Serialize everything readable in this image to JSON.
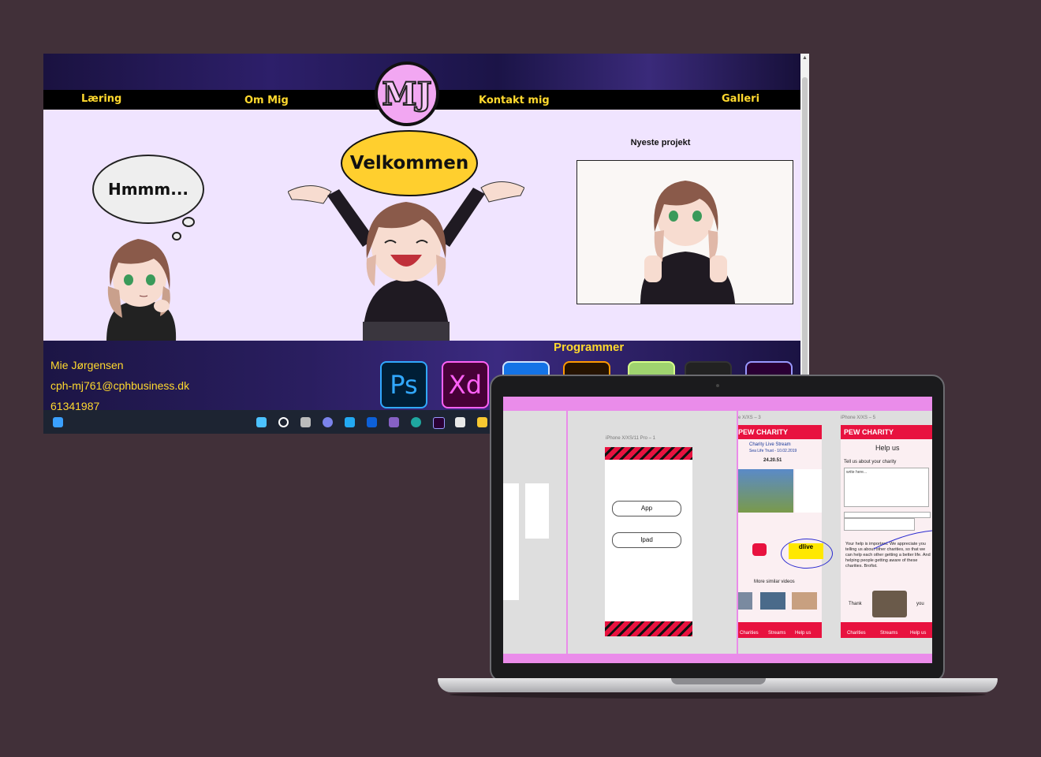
{
  "site": {
    "nav": [
      "Læring",
      "Om Mig",
      "Kontakt mig",
      "Galleri"
    ],
    "logo_text": "MJ",
    "thought_text": "Hmmm...",
    "welcome_text": "Velkommen",
    "project_title": "Nyeste projekt",
    "footer": {
      "programs_title": "Programmer",
      "name": "Mie Jørgensen",
      "email": "cph-mj761@cphbusiness.dk",
      "phone": "61341987"
    },
    "apps": [
      {
        "label": "Ps",
        "color": "#31a8ff",
        "bg": "#001e36"
      },
      {
        "label": "Xd",
        "color": "#ff61f6",
        "bg": "#470137"
      },
      {
        "label": "",
        "color": "#ffffff",
        "bg": "#1473e6"
      },
      {
        "label": "",
        "color": "#ff9a00",
        "bg": "#261300"
      },
      {
        "label": "",
        "color": "#d7ff8a",
        "bg": "#9fd36f"
      },
      {
        "label": "",
        "color": "#ffffff",
        "bg": "#222"
      },
      {
        "label": "",
        "color": "#9999ff",
        "bg": "#2a0034"
      }
    ]
  },
  "taskbar": {
    "icons": [
      "windows-icon",
      "search-icon",
      "task-view-icon",
      "chat-icon",
      "vscode-icon",
      "app-icon",
      "visual-studio-icon",
      "edge-icon",
      "premiere-icon",
      "store-icon",
      "python-icon"
    ]
  },
  "laptop": {
    "artboards": {
      "iphone_label": "iPhone X/XS/11 Pro – 1",
      "label_3": "e X/XS – 3",
      "label_5": "iPhone X/XS – 5",
      "btn_app": "App",
      "btn_ipad": "Ipad",
      "brand": "PEW CHARITY",
      "stream_title": "Charity Live Stream",
      "stream_sub": "Sea Life Trust - 10.02.2019",
      "timer": "24.20.51",
      "more_videos": "More similar videos",
      "dlive": "dlive",
      "help_title": "Help us",
      "help_sub": "Tell us about your charity",
      "help_placeholder": "write here...",
      "help_text": "Your help is important. We appreciate you telling us about other charities, so that we can help each other getting a better life. And helping people getting aware of these charities. Brofist.",
      "thank": "Thank",
      "you": "you",
      "nav_items": [
        "Charities",
        "Streams",
        "Help us"
      ]
    }
  }
}
